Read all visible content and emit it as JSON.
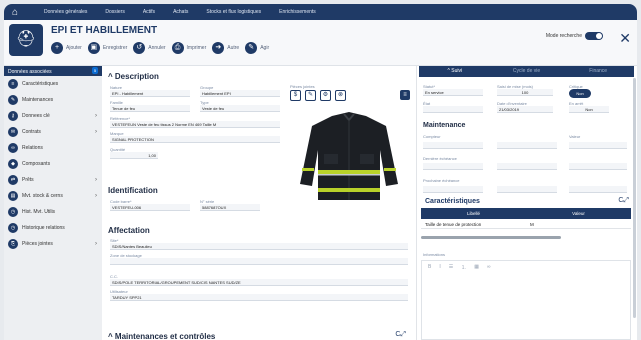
{
  "topnav": [
    "Données générales",
    "Dossiers",
    "Actifs",
    "Achats",
    "Stocks et flux logistiques",
    "Enrichissements"
  ],
  "header": {
    "title": "EPI ET HABILLEMENT",
    "toolbar": [
      "Ajouter",
      "Enregistrer",
      "Annuler",
      "Imprimer",
      "Autre",
      "Agir"
    ],
    "advanced_search_label": "Mode recherche",
    "advanced_search_toggle": "Actif"
  },
  "sidebar": {
    "title": "Données associées",
    "count": "5",
    "items": [
      {
        "label": "Caractéristiques",
        "chevron": false
      },
      {
        "label": "Maintenances",
        "chevron": false
      },
      {
        "label": "Donnees clé",
        "chevron": true
      },
      {
        "label": "Contrats",
        "chevron": true
      },
      {
        "label": "Relations",
        "chevron": false
      },
      {
        "label": "Composants",
        "chevron": false
      },
      {
        "label": "Prêts",
        "chevron": true
      },
      {
        "label": "Mvt. stock & cerns",
        "chevron": true
      },
      {
        "label": "Hist. Mvt. Utilis",
        "chevron": false
      },
      {
        "label": "Historique relations",
        "chevron": false
      },
      {
        "label": "Pièces jointes",
        "chevron": true
      }
    ]
  },
  "description": {
    "heading": "Description",
    "nature_label": "Nature",
    "nature": "EPI - Habillement",
    "groupe_label": "Groupe",
    "groupe": "Habillement EPI",
    "famille_label": "Famille",
    "famille": "Tenue de feu",
    "type_label": "Type",
    "type": "Veste de feu",
    "reference_label": "Référence*",
    "reference": "VESTEFEUN  Veste de feu tissus 2 Norme EN 469 Taille M",
    "marque_label": "Marque",
    "marque": "SIGNAL PROTECTION",
    "quantite_label": "Quantité",
    "quantite": "1,00",
    "photo_label": "Pièces jointes"
  },
  "identification": {
    "heading": "Identification",
    "code_label": "Code barre*",
    "code": "VESTEFEU-006",
    "serie_label": "N° série",
    "serie": "5887687OUX"
  },
  "affectation": {
    "heading": "Affectation",
    "site_label": "Site*",
    "site": "SDIS/Nantes Beaulieu",
    "zone_label": "Zone de stockage",
    "zone": "",
    "cc_label": "C.C.",
    "cc": "SDIS/POLE TERRITORIAL/GROUPEMENT SUD/CIS NANTES SUD/ZE",
    "util_label": "Utilisateur",
    "util": "TARDUY SPP21"
  },
  "bottom_section": "Maintenances et contrôles",
  "right": {
    "tabs": [
      "Suivi",
      "Cycle de vie",
      "Finance"
    ],
    "etat_label": "Statut*",
    "etat": "En service",
    "stock_label": "Saisi de mise (mois)",
    "stock": "100",
    "critique_label": "Critique",
    "critique": "Non",
    "etat2_label": "État",
    "date_label": "Date d'inventaire",
    "date": "21/03/2019",
    "enstock_label": "En arrêt",
    "enstock": "Non",
    "maintenance_heading": "Maintenance",
    "maint_rows": [
      "Compteur",
      "Dernière échéance",
      "Prochaine échéance"
    ],
    "maint_cols": [
      "Valeur"
    ],
    "carac_heading": "Caractéristiques",
    "table_headers": [
      "Libellé",
      "Valeur"
    ],
    "table_rows": [
      [
        "Taille de tenue de protection",
        "M"
      ]
    ],
    "info_label": "Informations"
  }
}
